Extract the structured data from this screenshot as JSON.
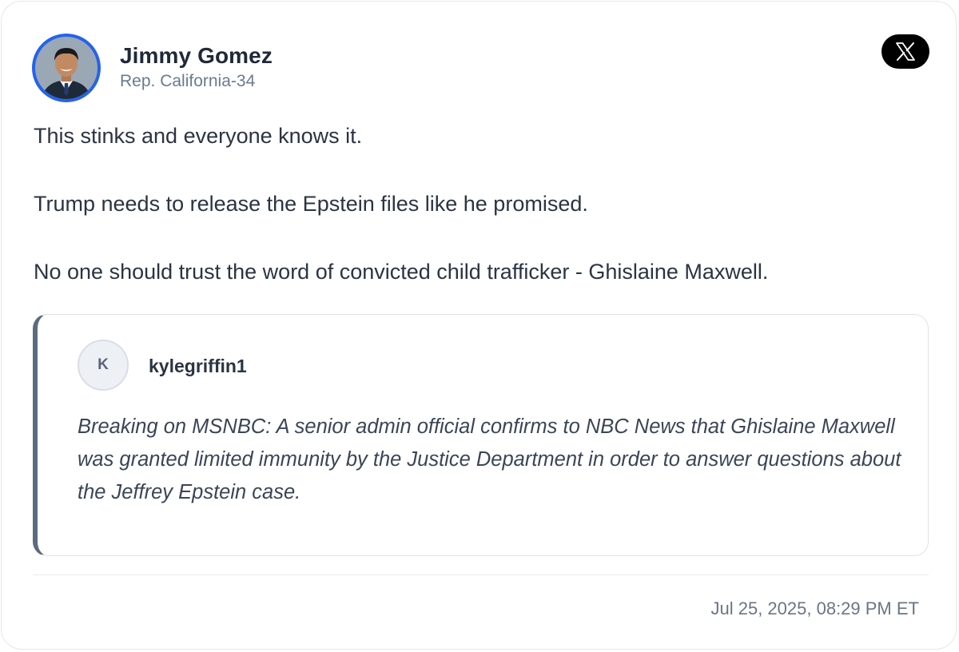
{
  "author": {
    "name": "Jimmy Gomez",
    "subtitle": "Rep. California-34"
  },
  "platform_icon": "x-logo-icon",
  "post": {
    "lines": [
      "This stinks and everyone knows it.",
      "Trump needs to release the Epstein files like he promised.",
      "No one should trust the word of convicted child trafficker - Ghislaine Maxwell."
    ]
  },
  "quoted": {
    "avatar_letter": "K",
    "handle": "kylegriffin1",
    "text": "Breaking on MSNBC: A senior admin official confirms to NBC News that Ghislaine Maxwell was granted limited immunity by the Justice Department in order to answer questions about the Jeffrey Epstein case."
  },
  "timestamp": "Jul 25, 2025, 08:29 PM ET",
  "colors": {
    "avatar_ring": "#2563eb",
    "quote_border": "#5b6b80",
    "text_primary": "#2b3442",
    "text_muted": "#6b7a8f"
  }
}
